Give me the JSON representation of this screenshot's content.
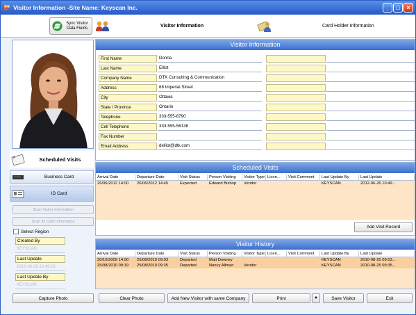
{
  "window": {
    "title": "Visitor Information -Site Name: Keyscan Inc.",
    "controls": [
      "minimize",
      "maximize",
      "close"
    ]
  },
  "toolbar": {
    "sync_label": "Sync Visitor Data Fields",
    "tabs": [
      {
        "label": "Visitor Information",
        "icon": "visitor-icon"
      },
      {
        "label": "Card Holder Information",
        "icon": "card-holder-icon"
      }
    ]
  },
  "left": {
    "scheduled_visits": "Scheduled Visits",
    "business_card": "Business Card",
    "id_card": "ID Card",
    "scan_visitor": "Scan Visitor Information",
    "scan_id": "Scan ID Card Information",
    "select_region": "Select Region",
    "created_by_label": "Created By",
    "created_by_value": "KEYSCAN",
    "last_update_label": "Last Update",
    "last_update_value": "2012-06-26 10:49:23",
    "last_update_by_label": "Last Update By",
    "last_update_by_value": "KEYSCAN"
  },
  "visitor_info": {
    "title": "Visitor Information",
    "fields": [
      {
        "label": "First Name",
        "value": "Donna"
      },
      {
        "label": "Last Name",
        "value": "Elliot"
      },
      {
        "label": "Company Name",
        "value": "DTK Consulting & Communication"
      },
      {
        "label": "Address",
        "value": "68 Imperial Street"
      },
      {
        "label": "City",
        "value": "Ottawa"
      },
      {
        "label": "State / Province",
        "value": "Ontario"
      },
      {
        "label": "Telephone",
        "value": "333-555-8790"
      },
      {
        "label": "Cell Telephone",
        "value": "333-555-56138"
      },
      {
        "label": "Fax Number",
        "value": ""
      },
      {
        "label": "Email Address",
        "value": "delliot@dtk.com"
      }
    ]
  },
  "columns": [
    "Arrival Date",
    "Departure Date",
    "Visit Status",
    "Person Visiting",
    "Visitor Type",
    "Licen...",
    "Visit Comment",
    "Last Update By",
    "Last Update"
  ],
  "scheduled_visits": {
    "title": "Scheduled Visits",
    "rows": [
      [
        "26/06/2012 14:00",
        "26/06/2012 14:45",
        "Expected",
        "Edward Bishop",
        "Vendor",
        "",
        "",
        "KEYSCAN",
        "2012-06-26 10:49..."
      ]
    ],
    "add_button": "Add Visit Record"
  },
  "visitor_history": {
    "title": "Visitor History",
    "rows": [
      [
        "30/10/2009 14:00",
        "25/08/2010 09:03",
        "Departed",
        "Matt Downey",
        "",
        "",
        "",
        "KEYSCAN",
        "2010-08-25 09:03..."
      ],
      [
        "25/08/2010 09:19",
        "25/08/2010 09:35",
        "Departed",
        "Nancy Allman",
        "Vendor",
        "",
        "",
        "KEYSCAN",
        "2010-08-25 09:35..."
      ]
    ]
  },
  "bottom": {
    "capture_photo": "Capture Photo",
    "clear_photo": "Clear Photo",
    "add_same_company": "Add New Visitor with same Company",
    "print": "Print",
    "save_visitor": "Save Visitor",
    "exit": "Exit"
  },
  "colors": {
    "title_bar": "#2458c8",
    "panel_header": "#3c6fcf",
    "label_bg": "#fdf8c5",
    "grid_bg": "#fde5c5"
  }
}
